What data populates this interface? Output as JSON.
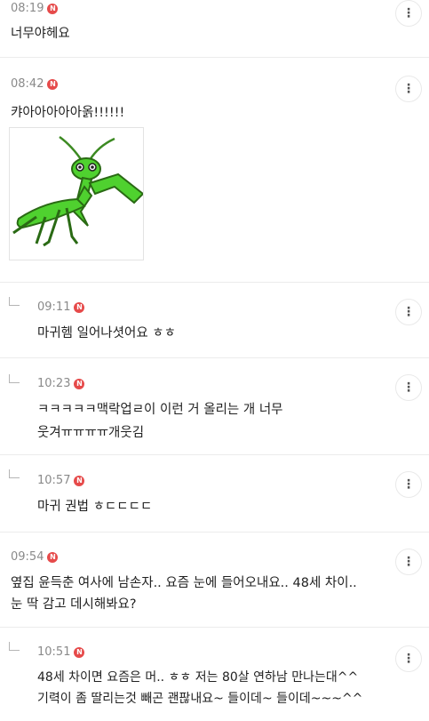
{
  "comments": [
    {
      "time": "08:19",
      "badge": "N",
      "text": "너무야헤요"
    },
    {
      "time": "08:42",
      "badge": "N",
      "text": "캬아아아아아옭!!!!!!",
      "image_desc": "mantis-icon"
    },
    {
      "time": "09:11",
      "badge": "N",
      "text": "마귀헴 일어나셧어요 ㅎㅎ"
    },
    {
      "time": "10:23",
      "badge": "N",
      "lines": [
        "ㅋㅋㅋㅋㅋ맥락업ㄹ이 이런 거 올리는 개 너무",
        "웃겨ㅠㅠㅠㅠ개웃김"
      ]
    },
    {
      "time": "10:57",
      "badge": "N",
      "text": "마귀 권법 ㅎㄷㄷㄷㄷ"
    },
    {
      "time": "09:54",
      "badge": "N",
      "lines": [
        "옆집 윤득춘 여사에 남손자.. 요즘 눈에 들어오내요.. 48세 차이..",
        "눈 딱 감고 데시해봐요?"
      ]
    },
    {
      "time": "10:51",
      "badge": "N",
      "lines": [
        "48세 차이면 요즘은 머.. ㅎㅎ 저는 80살 연하남 만나는대^^",
        "기력이 좀 딸리는것 빼곤 괜팒내요~ 들이데~ 들이데~~~^^"
      ]
    }
  ],
  "more_icon": "⋮"
}
